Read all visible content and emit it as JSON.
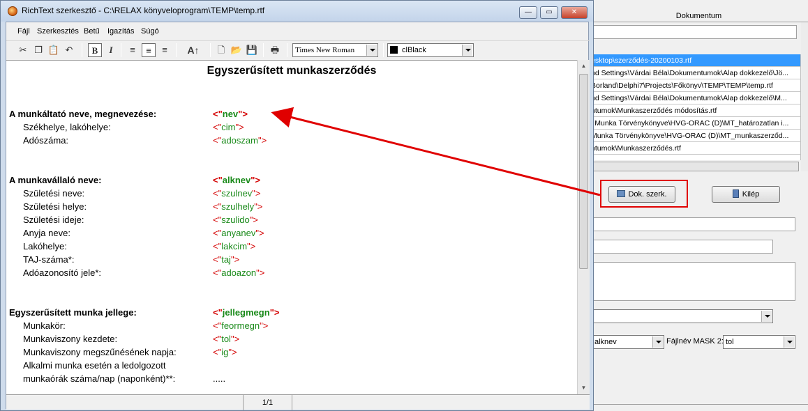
{
  "window": {
    "title": "RichText szerkesztő - C:\\RELAX könyveloprogram\\TEMP\\temp.rtf",
    "minimize": "—",
    "maximize": "▭",
    "close": "✕"
  },
  "menu": [
    "Fájl",
    "Szerkesztés",
    "Betű",
    "Igazítás",
    "Súgó"
  ],
  "toolbar": {
    "bold": "B",
    "italic": "I",
    "font": "Times New Roman",
    "color": "clBlack",
    "font_size_icon": "A↑"
  },
  "document": {
    "title": "Egyszerűsített munkaszerződés",
    "lines": [
      {
        "label": "A munkáltató neve, megnevezése:",
        "field": "nev",
        "bold": true,
        "indent": false
      },
      {
        "label": "Székhelye, lakóhelye:",
        "field": "cim",
        "bold": false,
        "indent": true
      },
      {
        "label": "Adószáma:",
        "field": "adoszam",
        "bold": false,
        "indent": true
      },
      {
        "label": "A munkavállaló neve:",
        "field": "alknev",
        "bold": true,
        "indent": false
      },
      {
        "label": "Születési neve:",
        "field": "szulnev",
        "bold": false,
        "indent": true
      },
      {
        "label": "Születési helye:",
        "field": "szulhely",
        "bold": false,
        "indent": true
      },
      {
        "label": "Születési ideje:",
        "field": "szulido",
        "bold": false,
        "indent": true
      },
      {
        "label": "Anyja neve:",
        "field": "anyanev",
        "bold": false,
        "indent": true
      },
      {
        "label": "Lakóhelye:",
        "field": "lakcim",
        "bold": false,
        "indent": true
      },
      {
        "label": "TAJ-száma*:",
        "field": "taj",
        "bold": false,
        "indent": true
      },
      {
        "label": "Adóazonosító jele*:",
        "field": "adoazon",
        "bold": false,
        "indent": true
      },
      {
        "label": "Egyszerűsített munka jellege:",
        "field": "jellegmegn",
        "bold": true,
        "indent": false
      },
      {
        "label": "Munkakör:",
        "field": "feormegn",
        "bold": false,
        "indent": true
      },
      {
        "label": "Munkaviszony kezdete:",
        "field": "tol",
        "bold": false,
        "indent": true
      },
      {
        "label": "Munkaviszony megszűnésének napja:",
        "field": "ig",
        "bold": false,
        "indent": true
      },
      {
        "label": "Alkalmi munka esetén a ledolgozott",
        "field": "",
        "bold": false,
        "indent": true
      },
      {
        "label": "munkaórák száma/nap (naponként)**:",
        "field": "",
        "value": ".....",
        "bold": false,
        "indent": true
      }
    ]
  },
  "status": {
    "page": "1/1"
  },
  "background": {
    "header": "Dokumentum",
    "files": [
      "esktop\\szerződés-20200103.rtf",
      "nd Settings\\Várdai Béla\\Dokumentumok\\Alap dokkezelő\\Jö...",
      "Borland\\Delphi7\\Projects\\Főkönyv\\TEMP\\TEMP\\temp.rtf",
      "nd Settings\\Várdai Béla\\Dokumentumok\\Alap dokkezelő\\M...",
      "ntumok\\Munkaszerződés módosítás.rtf",
      "j Munka Törvénykönyve\\HVG-ORAC (D)\\MT_határozatlan i...",
      "Munka Törvénykönyve\\HVG-ORAC (D)\\MT_munkaszerződ...",
      "ntumok\\Munkaszerződés.rtf"
    ],
    "dok_btn": "Dok. szerk.",
    "exit_btn": "Kilép",
    "mask1_value": "alknev",
    "mask2_label": "Fájlnév MASK 2:",
    "mask2_value": "tol"
  },
  "colors": {
    "field_quote": "#d40000",
    "field_name": "#1a8a1a",
    "annotation": "#e00000"
  }
}
